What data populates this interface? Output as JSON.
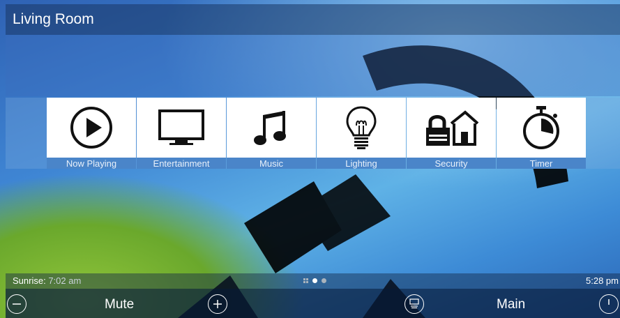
{
  "header": {
    "title": "Living Room"
  },
  "tiles": [
    {
      "label": "Now Playing",
      "icon": "play-icon"
    },
    {
      "label": "Entertainment",
      "icon": "tv-icon"
    },
    {
      "label": "Music",
      "icon": "music-note-icon"
    },
    {
      "label": "Lighting",
      "icon": "light-bulb-icon"
    },
    {
      "label": "Security",
      "icon": "lock-house-icon"
    },
    {
      "label": "Timer",
      "icon": "stopwatch-icon"
    }
  ],
  "status": {
    "sunrise_label": "Sunrise:",
    "sunrise_time": "7:02 am",
    "clock": "5:28 pm",
    "page_index": 1,
    "page_count": 2
  },
  "bottom": {
    "mute_label": "Mute",
    "main_label": "Main"
  },
  "colors": {
    "tile_bg": "#ffffff",
    "label_bar": "#4a85c9",
    "bar_dark": "#0a1e3c"
  }
}
